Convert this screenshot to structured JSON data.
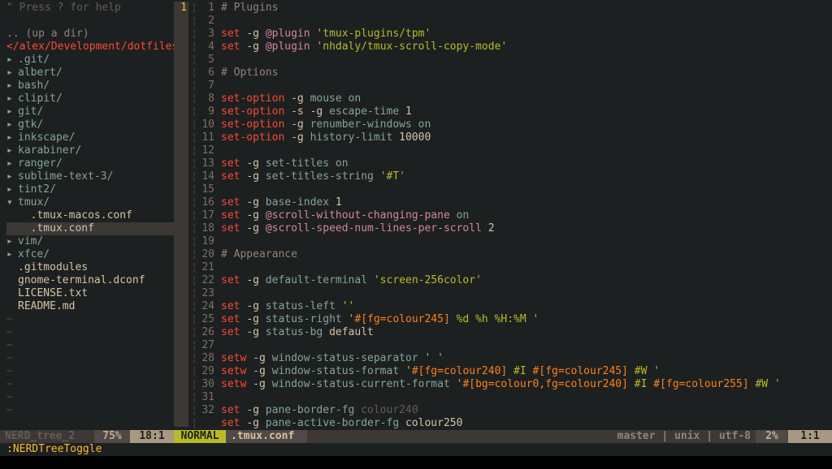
{
  "tree": {
    "help": "\" Press ? for help",
    "updir": ".. (up a dir)",
    "path": "</alex/Development/dotfiles/",
    "entries": [
      {
        "type": "folder",
        "open": false,
        "indent": 0,
        "name": ".git/"
      },
      {
        "type": "folder",
        "open": false,
        "indent": 0,
        "name": "albert/"
      },
      {
        "type": "folder",
        "open": false,
        "indent": 0,
        "name": "bash/"
      },
      {
        "type": "folder",
        "open": false,
        "indent": 0,
        "name": "clipit/"
      },
      {
        "type": "folder",
        "open": false,
        "indent": 0,
        "name": "git/"
      },
      {
        "type": "folder",
        "open": false,
        "indent": 0,
        "name": "gtk/"
      },
      {
        "type": "folder",
        "open": false,
        "indent": 0,
        "name": "inkscape/"
      },
      {
        "type": "folder",
        "open": false,
        "indent": 0,
        "name": "karabiner/"
      },
      {
        "type": "folder",
        "open": false,
        "indent": 0,
        "name": "ranger/"
      },
      {
        "type": "folder",
        "open": false,
        "indent": 0,
        "name": "sublime-text-3/"
      },
      {
        "type": "folder",
        "open": false,
        "indent": 0,
        "name": "tint2/"
      },
      {
        "type": "folder",
        "open": true,
        "indent": 0,
        "name": "tmux/"
      },
      {
        "type": "file",
        "indent": 1,
        "name": ".tmux-macos.conf"
      },
      {
        "type": "file",
        "indent": 1,
        "name": ".tmux.conf",
        "selected": true
      },
      {
        "type": "folder",
        "open": false,
        "indent": 0,
        "name": "vim/"
      },
      {
        "type": "folder",
        "open": false,
        "indent": 0,
        "name": "xfce/"
      },
      {
        "type": "file",
        "indent": 0,
        "name": ".gitmodules"
      },
      {
        "type": "file",
        "indent": 0,
        "name": "gnome-terminal.dconf"
      },
      {
        "type": "file",
        "indent": 0,
        "name": "LICENSE.txt"
      },
      {
        "type": "file",
        "indent": 0,
        "name": "README.md"
      }
    ],
    "tilde_rows": 8
  },
  "code": {
    "cursor_line_label": "1",
    "lines": [
      {
        "n": "",
        "tokens": [
          [
            "comment",
            "# Plugins"
          ]
        ]
      },
      {
        "n": "1",
        "tokens": []
      },
      {
        "n": "2",
        "tokens": [
          [
            "kw",
            "set "
          ],
          [
            "opt",
            "-g "
          ],
          [
            "at",
            "@plugin "
          ],
          [
            "str",
            "'tmux-plugins/tpm'"
          ]
        ]
      },
      {
        "n": "3",
        "tokens": [
          [
            "kw",
            "set "
          ],
          [
            "opt",
            "-g "
          ],
          [
            "at",
            "@plugin "
          ],
          [
            "str",
            "'nhdaly/tmux-scroll-copy-mode'"
          ]
        ]
      },
      {
        "n": "4",
        "tokens": []
      },
      {
        "n": "5",
        "tokens": [
          [
            "comment",
            "# Options"
          ]
        ]
      },
      {
        "n": "6",
        "tokens": []
      },
      {
        "n": "7",
        "tokens": [
          [
            "kw",
            "set-option "
          ],
          [
            "opt",
            "-g "
          ],
          [
            "ident",
            "mouse "
          ],
          [
            "on",
            "on"
          ]
        ]
      },
      {
        "n": "8",
        "tokens": [
          [
            "kw",
            "set-option "
          ],
          [
            "opt",
            "-s -g "
          ],
          [
            "ident",
            "escape-time "
          ],
          [
            "num",
            "1"
          ]
        ]
      },
      {
        "n": "9",
        "tokens": [
          [
            "kw",
            "set-option "
          ],
          [
            "opt",
            "-g "
          ],
          [
            "ident",
            "renumber-windows "
          ],
          [
            "on",
            "on"
          ]
        ]
      },
      {
        "n": "10",
        "tokens": [
          [
            "kw",
            "set-option "
          ],
          [
            "opt",
            "-g "
          ],
          [
            "ident",
            "history-limit "
          ],
          [
            "num",
            "10000"
          ]
        ]
      },
      {
        "n": "11",
        "tokens": []
      },
      {
        "n": "12",
        "tokens": [
          [
            "kw",
            "set "
          ],
          [
            "opt",
            "-g "
          ],
          [
            "ident",
            "set-titles "
          ],
          [
            "on",
            "on"
          ]
        ]
      },
      {
        "n": "13",
        "tokens": [
          [
            "kw",
            "set "
          ],
          [
            "opt",
            "-g "
          ],
          [
            "ident",
            "set-titles-string "
          ],
          [
            "str",
            "'#T'"
          ]
        ]
      },
      {
        "n": "14",
        "tokens": []
      },
      {
        "n": "15",
        "tokens": [
          [
            "kw",
            "set "
          ],
          [
            "opt",
            "-g "
          ],
          [
            "ident",
            "base-index "
          ],
          [
            "num",
            "1"
          ]
        ]
      },
      {
        "n": "16",
        "tokens": [
          [
            "kw",
            "set "
          ],
          [
            "opt",
            "-g "
          ],
          [
            "at",
            "@scroll-without-changing-pane "
          ],
          [
            "on",
            "on"
          ]
        ]
      },
      {
        "n": "17",
        "tokens": [
          [
            "kw",
            "set "
          ],
          [
            "opt",
            "-g "
          ],
          [
            "at",
            "@scroll-speed-num-lines-per-scroll "
          ],
          [
            "num",
            "2"
          ]
        ]
      },
      {
        "n": "18",
        "tokens": []
      },
      {
        "n": "19",
        "tokens": [
          [
            "comment",
            "# Appearance"
          ]
        ]
      },
      {
        "n": "20",
        "tokens": []
      },
      {
        "n": "21",
        "tokens": [
          [
            "kw",
            "set "
          ],
          [
            "opt",
            "-g "
          ],
          [
            "ident",
            "default-terminal "
          ],
          [
            "str",
            "'screen-256color'"
          ]
        ]
      },
      {
        "n": "22",
        "tokens": []
      },
      {
        "n": "23",
        "tokens": [
          [
            "kw",
            "set "
          ],
          [
            "opt",
            "-g "
          ],
          [
            "ident",
            "status-left "
          ],
          [
            "str",
            "''"
          ]
        ]
      },
      {
        "n": "24",
        "tokens": [
          [
            "kw",
            "set "
          ],
          [
            "opt",
            "-g "
          ],
          [
            "ident",
            "status-right "
          ],
          [
            "str",
            "'"
          ],
          [
            "strfmt",
            "#[fg=colour245]"
          ],
          [
            "str",
            " %d %h %H:%M '"
          ]
        ]
      },
      {
        "n": "25",
        "tokens": [
          [
            "kw",
            "set "
          ],
          [
            "opt",
            "-g "
          ],
          [
            "ident",
            "status-bg "
          ],
          [
            "opt",
            "default"
          ]
        ]
      },
      {
        "n": "26",
        "tokens": []
      },
      {
        "n": "27",
        "tokens": [
          [
            "kw",
            "setw "
          ],
          [
            "opt",
            "-g "
          ],
          [
            "ident",
            "window-status-separator "
          ],
          [
            "str",
            "' '"
          ]
        ]
      },
      {
        "n": "28",
        "tokens": [
          [
            "kw",
            "setw "
          ],
          [
            "opt",
            "-g "
          ],
          [
            "ident",
            "window-status-format "
          ],
          [
            "str",
            "'"
          ],
          [
            "strfmt",
            "#[fg=colour240]"
          ],
          [
            "str",
            " #I "
          ],
          [
            "strfmt",
            "#[fg=colour245]"
          ],
          [
            "str",
            " #W '"
          ]
        ]
      },
      {
        "n": "29",
        "tokens": [
          [
            "kw",
            "setw "
          ],
          [
            "opt",
            "-g "
          ],
          [
            "ident",
            "window-status-current-format "
          ],
          [
            "str",
            "'"
          ],
          [
            "strfmt",
            "#[bg=colour0,fg=colour240]"
          ],
          [
            "str",
            " #I "
          ],
          [
            "strfmt",
            "#[fg=colour255]"
          ],
          [
            "str",
            " #W '"
          ]
        ]
      },
      {
        "n": "30",
        "tokens": []
      },
      {
        "n": "31",
        "tokens": [
          [
            "kw",
            "set "
          ],
          [
            "opt",
            "-g "
          ],
          [
            "ident",
            "pane-border-fg "
          ],
          [
            "dim",
            "colour240"
          ]
        ]
      },
      {
        "n": "32",
        "tokens": [
          [
            "kw",
            "set "
          ],
          [
            "opt",
            "-g "
          ],
          [
            "ident",
            "pane-active-border-fg "
          ],
          [
            "plain",
            "colour250"
          ]
        ]
      }
    ]
  },
  "status": {
    "tree_name": "NERD_tree_2",
    "tree_pct": "75%",
    "tree_pos": "18:1",
    "mode": "NORMAL",
    "filename": ".tmux.conf",
    "meta": "master | unix | utf-8",
    "main_pct": "2%",
    "main_pos": "1:1"
  },
  "cmdline": ":NERDTreeToggle"
}
